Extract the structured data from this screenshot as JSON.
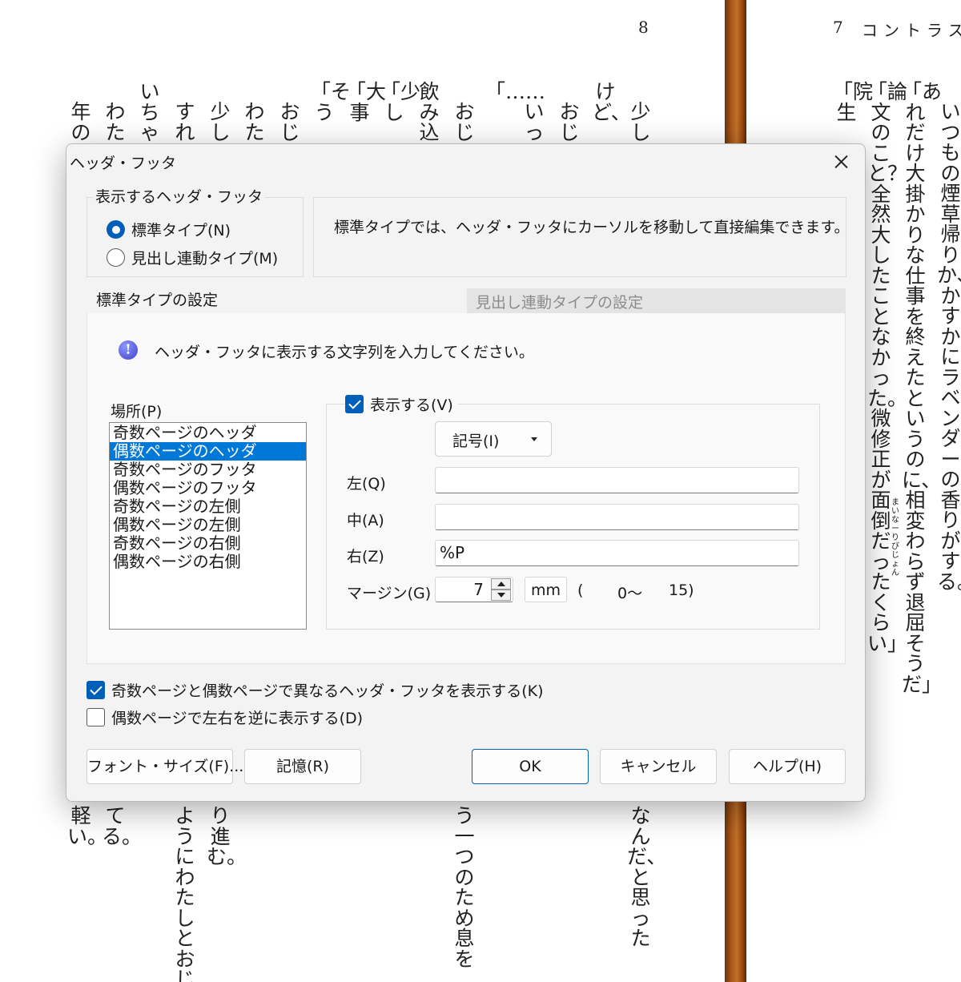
{
  "document": {
    "left_page_number": "8",
    "right_page_number": "7",
    "right_running_head": "コントラス",
    "top_fragments": [
      "少し",
      "けど、",
      "おじ",
      "いっ",
      "「……",
      "おじ",
      "飲み込",
      "「少し",
      "「大事",
      "「そう",
      "おじ",
      "わた",
      "少し",
      "すれ",
      "いちゃ",
      "わた",
      "年の"
    ],
    "bottom_fragments": [
      "なんだ、と思った",
      "う一つのため息を",
      "り進む。",
      "ようにわたしとおじ",
      "てる。",
      "軽い。"
    ],
    "right_columns": [
      "いつもの煙草帰りか、かすかにラベンダーの香りがする。",
      "「あれだけ大掛かりな仕事を終えたというのに、相変わらず退屈そうだ」",
      "「論文のこと？　全然大したことなかった。微修正が面倒だったくらい」",
      "「院生"
    ],
    "ruby": "まいなーりびじょん"
  },
  "dialog": {
    "title": "ヘッダ・フッタ",
    "display_group": {
      "legend": "表示するヘッダ・フッタ",
      "options": [
        "標準タイプ(N)",
        "見出し連動タイプ(M)"
      ],
      "selected_index": 0
    },
    "info_text": "標準タイプでは、ヘッダ・フッタにカーソルを移動して直接編集できます。",
    "tabs": [
      "標準タイプの設定",
      "見出し連動タイプの設定"
    ],
    "active_tab_index": 0,
    "panel": {
      "message": "ヘッダ・フッタに表示する文字列を入力してください。",
      "location_label": "場所(P)",
      "locations": [
        "奇数ページのヘッダ",
        "偶数ページのヘッダ",
        "奇数ページのフッタ",
        "偶数ページのフッタ",
        "奇数ページの左側",
        "偶数ページの左側",
        "奇数ページの右側",
        "偶数ページの右側"
      ],
      "selected_location_index": 1,
      "show_label": "表示する(V)",
      "show_checked": true,
      "symbol_button": "記号(I)",
      "left_label": "左(Q)",
      "left_value": "",
      "center_label": "中(A)",
      "center_value": "",
      "right_label": "右(Z)",
      "right_value": "%P",
      "margin_label": "マージン(G)",
      "margin_value": "7",
      "margin_unit": "mm",
      "range_open": "(",
      "range_min": "0〜",
      "range_max": "15)"
    },
    "odd_even_label": "奇数ページと偶数ページで異なるヘッダ・フッタを表示する(K)",
    "odd_even_checked": true,
    "mirror_label": "偶数ページで左右を逆に表示する(D)",
    "mirror_checked": false,
    "buttons": {
      "font_size": "フォント・サイズ(F)...",
      "remember": "記憶(R)",
      "ok": "OK",
      "cancel": "キャンセル",
      "help": "ヘルプ(H)"
    }
  },
  "colors": {
    "accent": "#005fb8",
    "selection": "#0078d7",
    "dialog_bg": "#f3f3f3",
    "spine": "#b0611f"
  }
}
